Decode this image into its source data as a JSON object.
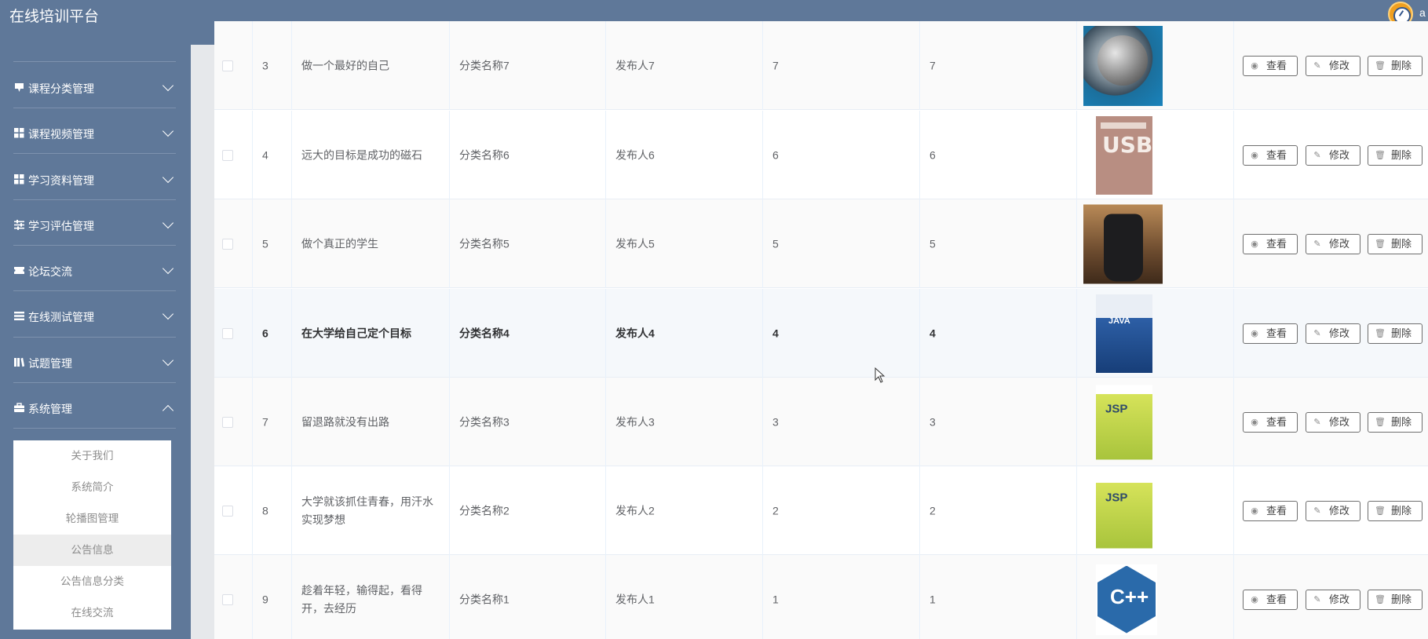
{
  "app": {
    "title": "在线培训平台",
    "user_initial": "a"
  },
  "sidebar": {
    "items": [
      {
        "label": "课程分类管理",
        "icon": "bookmark-icon",
        "expanded": false
      },
      {
        "label": "课程视频管理",
        "icon": "grid-icon",
        "expanded": false
      },
      {
        "label": "学习资料管理",
        "icon": "grid-icon",
        "expanded": false
      },
      {
        "label": "学习评估管理",
        "icon": "sliders-icon",
        "expanded": false
      },
      {
        "label": "论坛交流",
        "icon": "ticket-icon",
        "expanded": false
      },
      {
        "label": "在线测试管理",
        "icon": "list-icon",
        "expanded": false
      },
      {
        "label": "试题管理",
        "icon": "books-icon",
        "expanded": false
      },
      {
        "label": "系统管理",
        "icon": "briefcase-icon",
        "expanded": true
      }
    ],
    "submenu": [
      {
        "label": "关于我们",
        "active": false
      },
      {
        "label": "系统简介",
        "active": false
      },
      {
        "label": "轮播图管理",
        "active": false
      },
      {
        "label": "公告信息",
        "active": true
      },
      {
        "label": "公告信息分类",
        "active": false
      },
      {
        "label": "在线交流",
        "active": false
      }
    ]
  },
  "table": {
    "rows": [
      {
        "index": "3",
        "title": "做一个最好的自己",
        "category": "分类名称7",
        "publisher": "发布人7",
        "col1": "7",
        "col2": "7",
        "image": "planet-image"
      },
      {
        "index": "4",
        "title": "远大的目标是成功的磁石",
        "category": "分类名称6",
        "publisher": "发布人6",
        "col1": "6",
        "col2": "6",
        "image": "usb-book-image"
      },
      {
        "index": "5",
        "title": "做个真正的学生",
        "category": "分类名称5",
        "publisher": "发布人5",
        "col1": "5",
        "col2": "5",
        "image": "bag-image"
      },
      {
        "index": "6",
        "title": "在大学给自己定个目标",
        "category": "分类名称4",
        "publisher": "发布人4",
        "col1": "4",
        "col2": "4",
        "image": "java-book-image"
      },
      {
        "index": "7",
        "title": "留退路就没有出路",
        "category": "分类名称3",
        "publisher": "发布人3",
        "col1": "3",
        "col2": "3",
        "image": "jsp-book-image"
      },
      {
        "index": "8",
        "title": "大学就该抓住青春，用汗水实现梦想",
        "category": "分类名称2",
        "publisher": "发布人2",
        "col1": "2",
        "col2": "2",
        "image": "jsp-book-image"
      },
      {
        "index": "9",
        "title": "趁着年轻，输得起，看得开，去经历",
        "category": "分类名称1",
        "publisher": "发布人1",
        "col1": "1",
        "col2": "1",
        "image": "cpp-logo-image"
      }
    ],
    "actions": {
      "view": "查看",
      "edit": "修改",
      "delete": "删除"
    }
  }
}
